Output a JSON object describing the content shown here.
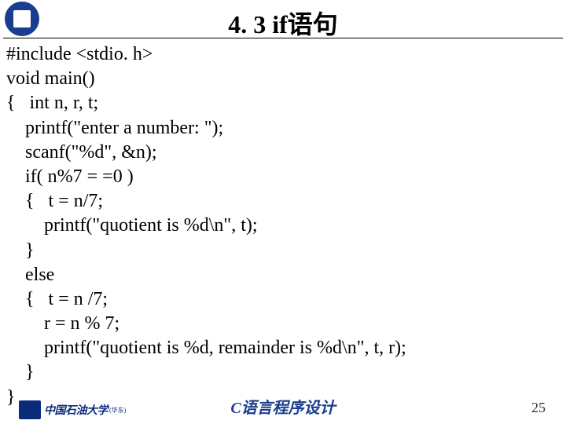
{
  "title": "4. 3  if语句",
  "code": "#include <stdio. h>\nvoid main()\n{   int n, r, t;\n    printf(\"enter a number: \");\n    scanf(\"%d\", &n);\n    if( n%7 = =0 )\n    {   t = n/7;\n        printf(\"quotient is %d\\n\", t);\n    }\n    else\n    {   t = n /7;\n        r = n % 7;\n        printf(\"quotient is %d, remainder is %d\\n\", t, r);\n    }\n}",
  "footer_logo_text": "中国石油大学",
  "footer_logo_sub": "(华东)",
  "footer_center": "C语言程序设计",
  "page_number": "25"
}
